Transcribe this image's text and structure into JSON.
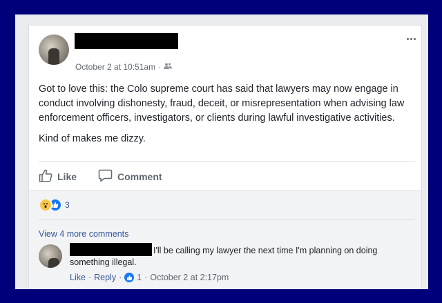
{
  "post": {
    "timestamp": "October 2 at 10:51am",
    "separator": "·",
    "privacy_icon": "friends-icon",
    "more_icon": "more-options-icon",
    "paragraphs": [
      "Got to love this: the Colo supreme court has said that lawyers may now engage in conduct involving dishonesty, fraud, deceit, or misrepresentation when advising law enforcement officers, investigators, or clients during lawful investigative activities.",
      "Kind of makes me dizzy."
    ]
  },
  "actions": {
    "like_label": "Like",
    "comment_label": "Comment"
  },
  "reactions": {
    "count": "3",
    "types": [
      "wow",
      "like"
    ]
  },
  "comments": {
    "view_more": "View 4 more comments",
    "items": [
      {
        "text": "I'll be calling my lawyer the next time I'm planning on doing something illegal.",
        "like_label": "Like",
        "reply_label": "Reply",
        "reaction_count": "1",
        "timestamp": "October 2 at 2:17pm",
        "separator": "·"
      }
    ]
  },
  "colors": {
    "border": "#00007a",
    "link": "#385898",
    "like_blue": "#1877f2"
  }
}
